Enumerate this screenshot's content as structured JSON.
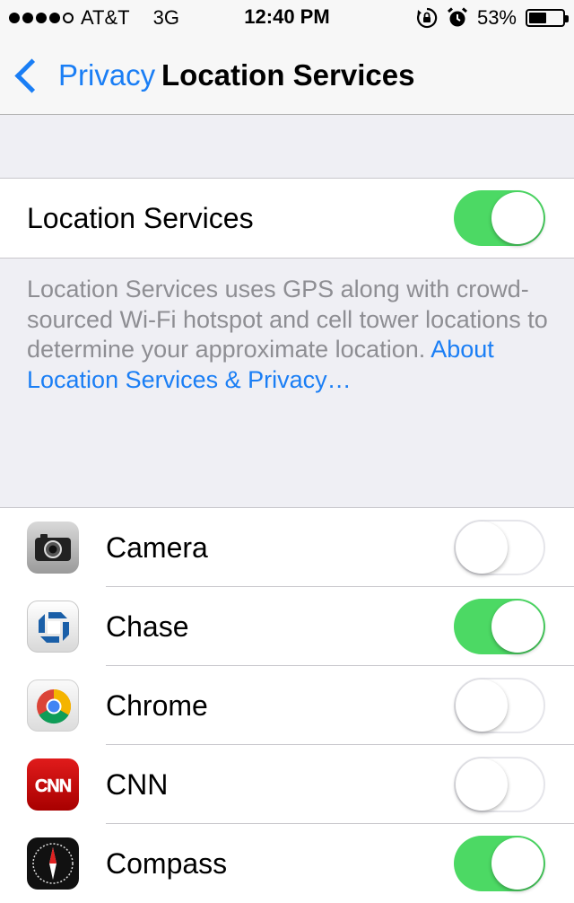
{
  "status_bar": {
    "carrier": "AT&T",
    "network": "3G",
    "time": "12:40 PM",
    "battery_percent": "53%",
    "battery_level": 0.53,
    "signal_bars_filled": 4,
    "signal_bars_total": 5
  },
  "nav": {
    "back_label": "Privacy",
    "title": "Location Services"
  },
  "master": {
    "label": "Location Services",
    "enabled": true
  },
  "description": {
    "text": "Location Services uses GPS along with crowd-sourced Wi-Fi hotspot and cell tower locations to determine your approximate location. ",
    "link": "About Location Services & Privacy…"
  },
  "apps": [
    {
      "name": "Camera",
      "enabled": false,
      "icon": "camera-icon"
    },
    {
      "name": "Chase",
      "enabled": true,
      "icon": "chase-icon"
    },
    {
      "name": "Chrome",
      "enabled": false,
      "icon": "chrome-icon"
    },
    {
      "name": "CNN",
      "enabled": false,
      "icon": "cnn-icon"
    },
    {
      "name": "Compass",
      "enabled": true,
      "icon": "compass-icon"
    }
  ],
  "colors": {
    "accent": "#1a7ef5",
    "switch_on": "#4cd964",
    "cnn_red": "#cc0000",
    "chase_blue": "#1a5fa8"
  }
}
